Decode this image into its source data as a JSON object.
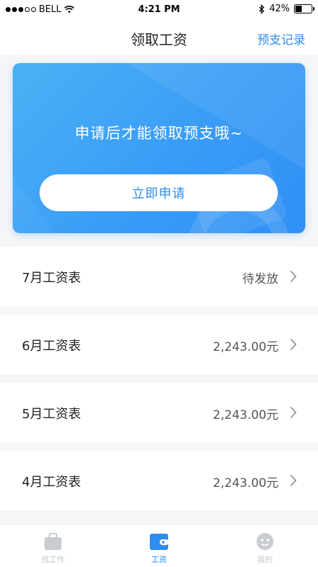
{
  "status_bar": {
    "carrier": "BELL",
    "time": "4:21 PM",
    "battery": "42%",
    "battery_level": 0.42,
    "signal_bars": 3,
    "signal_total": 5
  },
  "header": {
    "title": "领取工资",
    "action_label": "预支记录"
  },
  "banner": {
    "message": "申请后才能领取预支哦~",
    "button_label": "立即申请"
  },
  "payroll": [
    {
      "label": "7月工资表",
      "value": "待发放"
    },
    {
      "label": "6月工资表",
      "value": "2,243.00元"
    },
    {
      "label": "5月工资表",
      "value": "2,243.00元"
    },
    {
      "label": "4月工资表",
      "value": "2,243.00元"
    }
  ],
  "tabs": [
    {
      "label": "找工作",
      "icon": "briefcase-icon",
      "active": false
    },
    {
      "label": "工资",
      "icon": "wallet-icon",
      "active": true
    },
    {
      "label": "我的",
      "icon": "profile-icon",
      "active": false
    }
  ],
  "colors": {
    "accent": "#2b8ef0",
    "banner_start": "#4bb1f5",
    "banner_end": "#2f8ff5",
    "background": "#f5f6f8",
    "inactive_tab": "#c4c7cc"
  }
}
